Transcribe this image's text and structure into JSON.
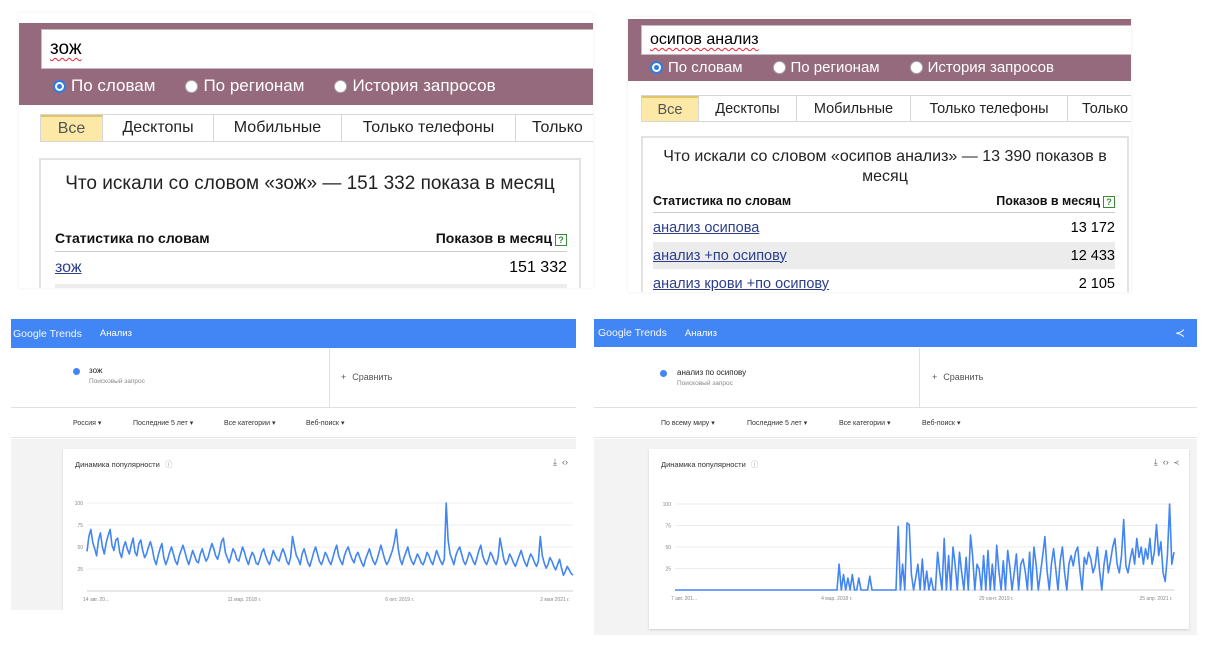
{
  "wordstat_left": {
    "query": "зож",
    "radios": [
      "По словам",
      "По регионам",
      "История запросов"
    ],
    "tabs": [
      "Все",
      "Десктопы",
      "Мобильные",
      "Только телефоны",
      "Только"
    ],
    "title": "Что искали со словом «зож» — 151 332 показа в месяц",
    "col_words": "Статистика по словам",
    "col_shows": "Показов в месяц",
    "help": "?",
    "rows": [
      {
        "phrase": "зож",
        "count": "151 332"
      }
    ]
  },
  "wordstat_right": {
    "query": "осипов анализ",
    "radios": [
      "По словам",
      "По регионам",
      "История запросов"
    ],
    "tabs": [
      "Все",
      "Десктопы",
      "Мобильные",
      "Только телефоны",
      "Только"
    ],
    "title": "Что искали со словом «осипов анализ» — 13 390 показов в месяц",
    "col_words": "Статистика по словам",
    "col_shows": "Показов в месяц",
    "help": "?",
    "rows": [
      {
        "phrase": "анализ осипова",
        "count": "13 172"
      },
      {
        "phrase": "анализ +по осипову",
        "count": "12 433"
      },
      {
        "phrase": "анализ крови +по осипову",
        "count": "2 105"
      }
    ]
  },
  "trends_left": {
    "logo": "Google Trends",
    "section": "Анализ",
    "term": "зож",
    "term_sub": "Поисковый запрос",
    "compare": "Сравнить",
    "filters": [
      "Россия",
      "Последние 5 лет",
      "Все категории",
      "Веб-поиск"
    ],
    "card_title": "Динамика популярности",
    "icons": [
      "download-icon",
      "embed-icon"
    ],
    "accent": "#4285f4"
  },
  "trends_right": {
    "logo": "Google Trends",
    "section": "Анализ",
    "term": "анализ по осипову",
    "term_sub": "Поисковый запрос",
    "compare": "Сравнить",
    "filters": [
      "По всему миру",
      "Последние 5 лет",
      "Все категории",
      "Веб-поиск"
    ],
    "card_title": "Динамика популярности",
    "icons": [
      "download-icon",
      "embed-icon",
      "share-icon"
    ],
    "accent": "#4285f4"
  },
  "chart_data": [
    {
      "type": "line",
      "yticks": [
        "100",
        "75",
        "50",
        "25"
      ],
      "xticks": [
        "14 авг. 20...",
        "11 мар. 2018 г.",
        "6 окт. 2019 г.",
        "2 мая 2021 г."
      ],
      "ylim": [
        0,
        100
      ],
      "series": [
        {
          "values": [
            45,
            62,
            70,
            55,
            48,
            40,
            58,
            66,
            50,
            42,
            55,
            63,
            70,
            52,
            46,
            58,
            60,
            44,
            38,
            50,
            56,
            48,
            42,
            52,
            60,
            44,
            40,
            54,
            58,
            46,
            38,
            42,
            50,
            56,
            48,
            36,
            30,
            40,
            48,
            54,
            38,
            30,
            36,
            44,
            50,
            42,
            34,
            30,
            40,
            46,
            52,
            44,
            36,
            30,
            38,
            46,
            40,
            34,
            32,
            42,
            48,
            40,
            34,
            38,
            46,
            54,
            48,
            40,
            36,
            44,
            56,
            60,
            44,
            38,
            32,
            40,
            48,
            44,
            36,
            34,
            42,
            50,
            44,
            36,
            30,
            38,
            44,
            40,
            32,
            30,
            36,
            44,
            48,
            40,
            34,
            30,
            38,
            46,
            40,
            36,
            34,
            42,
            48,
            42,
            34,
            30,
            38,
            62,
            50,
            40,
            36,
            30,
            42,
            48,
            40,
            32,
            28,
            36,
            44,
            50,
            42,
            34,
            30,
            36,
            44,
            40,
            34,
            30,
            38,
            46,
            52,
            40,
            34,
            30,
            40,
            46,
            50,
            42,
            36,
            32,
            40,
            44,
            38,
            32,
            28,
            36,
            42,
            48,
            40,
            34,
            30,
            36,
            44,
            52,
            44,
            36,
            30,
            34,
            40,
            46,
            56,
            70,
            48,
            36,
            30,
            38,
            44,
            50,
            40,
            34,
            30,
            36,
            42,
            38,
            32,
            30,
            36,
            44,
            40,
            34,
            30,
            38,
            46,
            40,
            34,
            30,
            36,
            100,
            58,
            42,
            36,
            30,
            40,
            46,
            50,
            42,
            34,
            30,
            36,
            44,
            40,
            34,
            30,
            38,
            46,
            52,
            40,
            34,
            30,
            36,
            44,
            40,
            34,
            30,
            38,
            60,
            48,
            36,
            30,
            34,
            42,
            38,
            32,
            28,
            34,
            40,
            46,
            38,
            32,
            28,
            36,
            42,
            38,
            32,
            28,
            34,
            62,
            40,
            32,
            26,
            30,
            38,
            34,
            28,
            24,
            30,
            36,
            26,
            18,
            22,
            28,
            24,
            20,
            18
          ]
        }
      ]
    },
    {
      "type": "line",
      "yticks": [
        "100",
        "75",
        "50",
        "25"
      ],
      "xticks": [
        "7 авг. 201...",
        "4 мар. 2018 г.",
        "29 сент. 2019 г.",
        "25 апр. 2021 г."
      ],
      "ylim": [
        0,
        100
      ],
      "series": [
        {
          "values": [
            0,
            0,
            0,
            0,
            0,
            0,
            0,
            0,
            0,
            0,
            0,
            0,
            0,
            0,
            0,
            0,
            0,
            0,
            0,
            0,
            0,
            0,
            0,
            0,
            0,
            0,
            0,
            0,
            0,
            0,
            0,
            0,
            0,
            0,
            0,
            0,
            0,
            0,
            0,
            0,
            0,
            0,
            0,
            0,
            0,
            0,
            0,
            0,
            0,
            0,
            0,
            0,
            0,
            0,
            0,
            0,
            0,
            0,
            0,
            0,
            0,
            0,
            0,
            0,
            0,
            0,
            0,
            0,
            0,
            0,
            0,
            0,
            0,
            0,
            0,
            30,
            0,
            18,
            0,
            14,
            0,
            18,
            0,
            0,
            14,
            0,
            0,
            0,
            0,
            16,
            0,
            0,
            0,
            0,
            0,
            0,
            0,
            0,
            0,
            0,
            0,
            0,
            74,
            0,
            30,
            0,
            78,
            76,
            18,
            0,
            14,
            30,
            0,
            36,
            0,
            22,
            0,
            14,
            0,
            0,
            44,
            20,
            0,
            60,
            0,
            40,
            0,
            50,
            30,
            0,
            44,
            20,
            0,
            38,
            0,
            64,
            40,
            0,
            30,
            24,
            0,
            40,
            0,
            46,
            0,
            30,
            0,
            52,
            22,
            0,
            34,
            0,
            46,
            26,
            0,
            20,
            42,
            0,
            30,
            36,
            22,
            0,
            44,
            0,
            50,
            30,
            0,
            20,
            40,
            62,
            22,
            0,
            30,
            48,
            24,
            0,
            34,
            50,
            20,
            0,
            30,
            40,
            28,
            44,
            50,
            22,
            0,
            38,
            30,
            44,
            36,
            20,
            28,
            50,
            22,
            0,
            30,
            46,
            20,
            34,
            50,
            60,
            30,
            20,
            40,
            82,
            28,
            20,
            36,
            48,
            30,
            60,
            38,
            50,
            30,
            48,
            36,
            60,
            30,
            44,
            76,
            40,
            56,
            20,
            10,
            40,
            100,
            30,
            44
          ]
        }
      ]
    }
  ]
}
